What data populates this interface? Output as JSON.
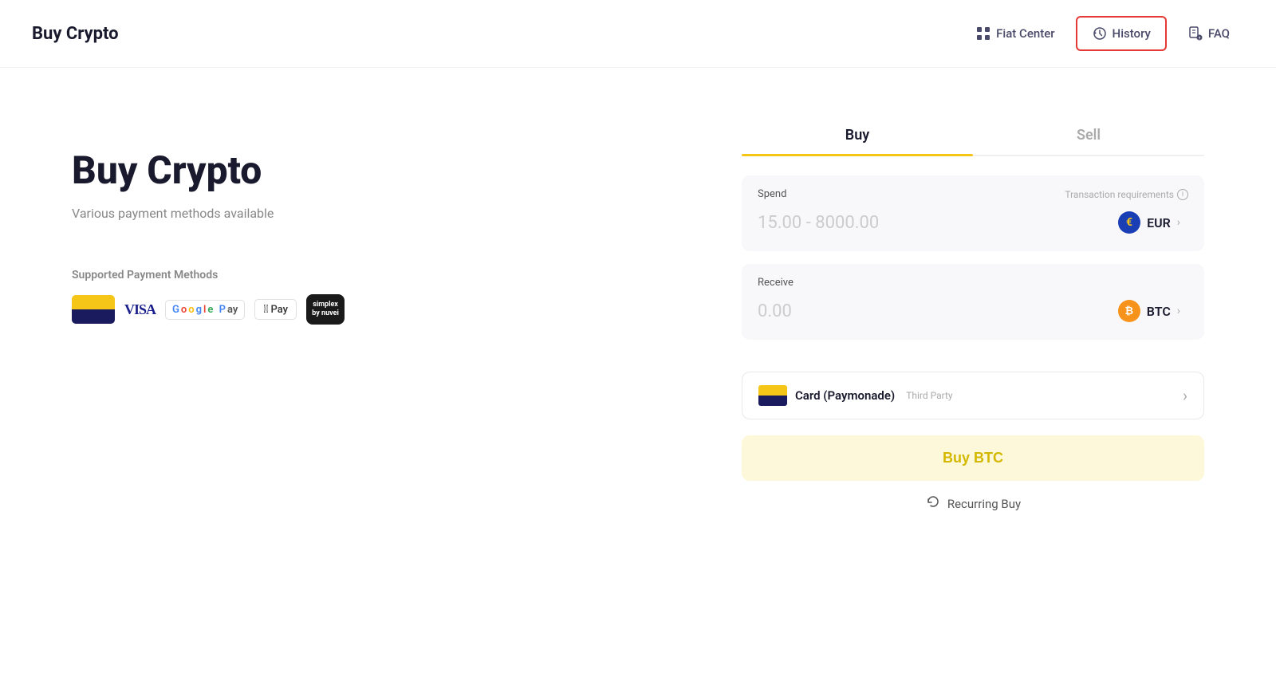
{
  "header": {
    "title": "Buy Crypto",
    "nav": [
      {
        "id": "fiat-center",
        "label": "Fiat Center",
        "icon": "grid"
      },
      {
        "id": "history",
        "label": "History",
        "icon": "history",
        "active": true
      },
      {
        "id": "faq",
        "label": "FAQ",
        "icon": "faq"
      }
    ]
  },
  "left": {
    "heading": "Buy Crypto",
    "subtitle": "Various payment methods available",
    "payment_methods_label": "Supported Payment Methods"
  },
  "tabs": [
    {
      "id": "buy",
      "label": "Buy",
      "active": true
    },
    {
      "id": "sell",
      "label": "Sell",
      "active": false
    }
  ],
  "spend_field": {
    "label": "Spend",
    "transaction_req_label": "Transaction requirements",
    "placeholder": "15.00 - 8000.00",
    "currency": "EUR"
  },
  "receive_field": {
    "label": "Receive",
    "placeholder": "0.00",
    "currency": "BTC"
  },
  "payment_method": {
    "name": "Card (Paymonade)",
    "tag": "Third Party"
  },
  "buy_button": {
    "label": "Buy BTC"
  },
  "recurring": {
    "label": "Recurring Buy"
  }
}
